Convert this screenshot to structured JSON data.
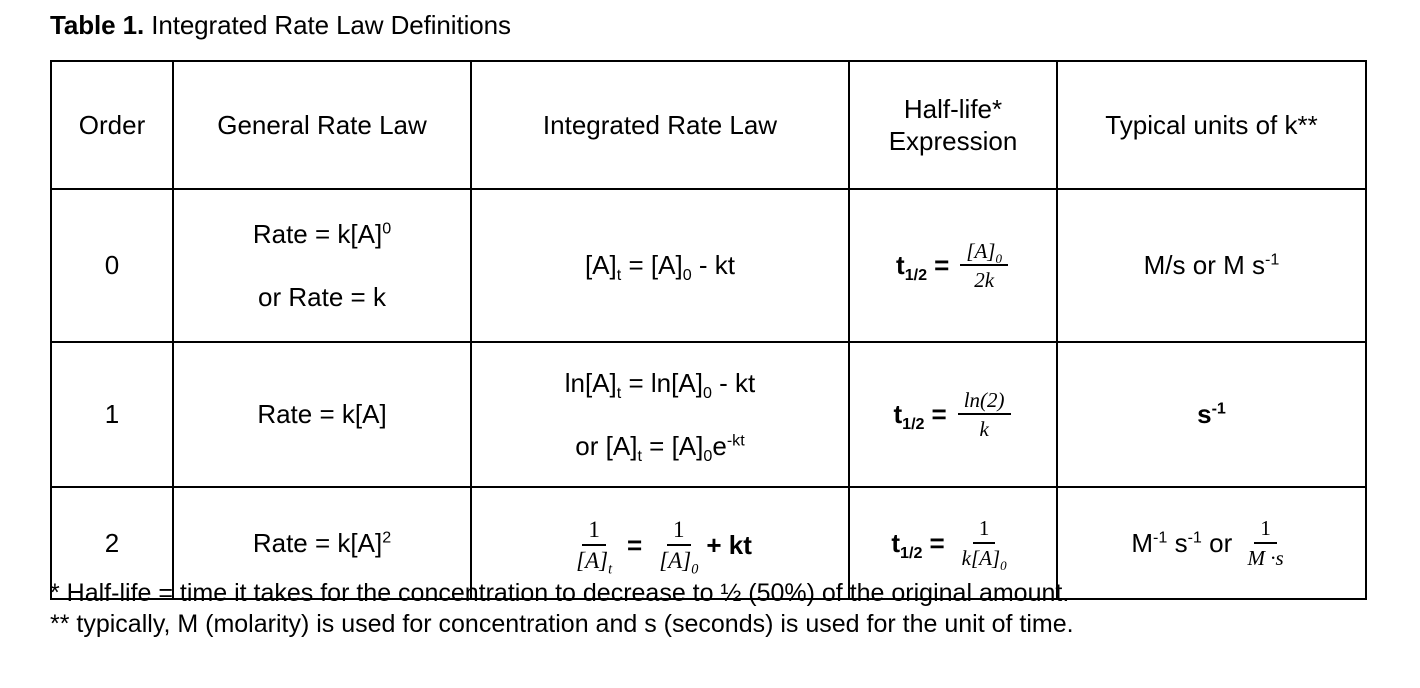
{
  "caption": {
    "lead": "Table 1.",
    "text": " Integrated Rate Law Definitions"
  },
  "table": {
    "headers": {
      "order": "Order",
      "general_rate_law": "General Rate Law",
      "integrated_rate_law": "Integrated Rate Law",
      "half_life_line1": "Half-life*",
      "half_life_line2": "Expression",
      "units": "Typical units of k**"
    },
    "rows": [
      {
        "order": "0",
        "general_rate_law_line1": "Rate = k[A]0",
        "general_rate_law_line2": "or Rate = k",
        "integrated_rate_law": "[A]t = [A]0 - kt",
        "half_life": "t1/2 = [A]0 / 2k",
        "half_life_numerator": "[A]",
        "half_life_numerator_sub": "0",
        "half_life_denominator": "2k",
        "units": "M/s or M s-1"
      },
      {
        "order": "1",
        "general_rate_law_line1": "Rate = k[A]",
        "integrated_rate_law_line1": "ln[A]t = ln[A]0 - kt",
        "integrated_rate_law_line2": "or [A]t = [A]0e-kt",
        "half_life": "t1/2 = ln(2) / k",
        "half_life_numerator": "ln(2)",
        "half_life_denominator": "k",
        "units": "s-1"
      },
      {
        "order": "2",
        "general_rate_law_line1": "Rate = k[A]2",
        "integrated_rate_law": "1/[A]t = 1/[A]0 + kt",
        "half_life": "t1/2 = 1 / k[A]0",
        "half_life_numerator": "1",
        "half_life_denominator": "k[A]",
        "half_life_denominator_sub": "0",
        "units": "M-1 s-1 or 1 / M·s"
      }
    ]
  },
  "symbols": {
    "t_half_label": "t",
    "t_half_sub": "1/2",
    "equals": "=",
    "rate": "Rate",
    "or": "or",
    "k": "k",
    "kt": "kt",
    "minus": "-",
    "plus": "+",
    "ln": "ln",
    "bracket_a": "[A]",
    "sub_t": "t",
    "sub_0": "0",
    "exp_0": "0",
    "exp_2": "2",
    "exp_neg1": "-1",
    "exp_neg_kt": "-kt",
    "e_char": "e",
    "one": "1",
    "two_k": "2k",
    "ln2": "ln(2)",
    "m_dot_s": "M ·s",
    "m_per_s": "M/s",
    "m_char": "M",
    "s_char": "s"
  },
  "footnotes": {
    "line1": "* Half-life = time it takes for the concentration to decrease to ½ (50%) of the original amount.",
    "line2": "** typically, M (molarity) is used for concentration and s (seconds) is used for the unit of time."
  },
  "colors": {
    "text": "#000000",
    "border": "#000000",
    "background": "#ffffff"
  }
}
